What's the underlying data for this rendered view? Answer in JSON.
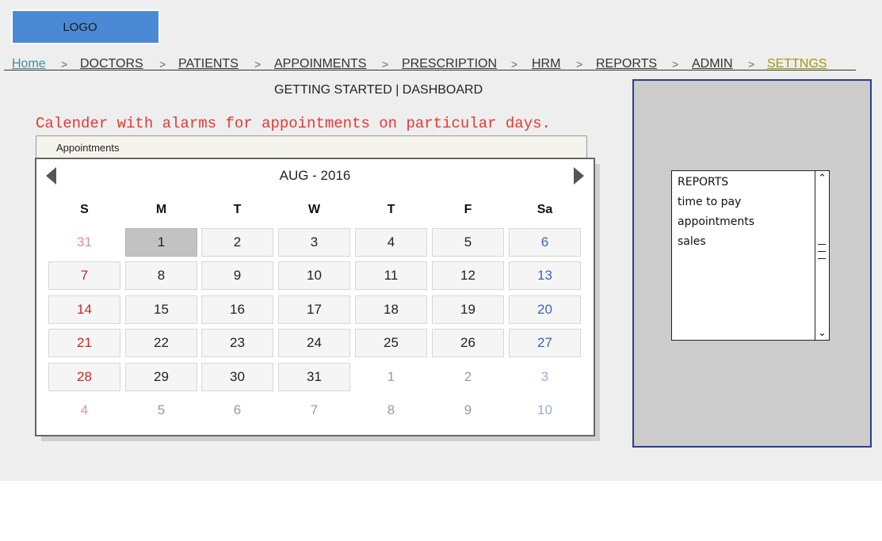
{
  "logo": {
    "text": "LOGO"
  },
  "nav": {
    "items": [
      {
        "label": "Home",
        "color": "#3a8fa0"
      },
      {
        "label": "DOCTORS"
      },
      {
        "label": "PATIENTS"
      },
      {
        "label": "APPOINMENTS"
      },
      {
        "label": "PRESCRIPTION"
      },
      {
        "label": "HRM"
      },
      {
        "label": "REPORTS"
      },
      {
        "label": "ADMIN"
      },
      {
        "label": "SETTNGS",
        "color": "#9a9a10"
      }
    ],
    "separator": ">"
  },
  "page": {
    "subtitle": "GETTING STARTED | DASHBOARD",
    "note": "Calender with alarms for appointments on particular days."
  },
  "calendar": {
    "tab_label": "Appointments",
    "month_label": "AUG - 2016",
    "weekdays": [
      "S",
      "M",
      "T",
      "W",
      "T",
      "F",
      "Sa"
    ],
    "selected_day": "1",
    "weeks": [
      [
        "31",
        "1",
        "2",
        "3",
        "4",
        "5",
        "6"
      ],
      [
        "7",
        "8",
        "9",
        "10",
        "11",
        "12",
        "13"
      ],
      [
        "14",
        "15",
        "16",
        "17",
        "18",
        "19",
        "20"
      ],
      [
        "21",
        "22",
        "23",
        "24",
        "25",
        "26",
        "27"
      ],
      [
        "28",
        "29",
        "30",
        "31",
        "1",
        "2",
        "3"
      ],
      [
        "4",
        "5",
        "6",
        "7",
        "8",
        "9",
        "10"
      ]
    ],
    "colors": {
      "sunday": "#c62828",
      "saturday": "#3b64b8"
    }
  },
  "side_panel": {
    "list": [
      "REPORTS",
      "time to pay",
      "appointments",
      "sales"
    ]
  }
}
